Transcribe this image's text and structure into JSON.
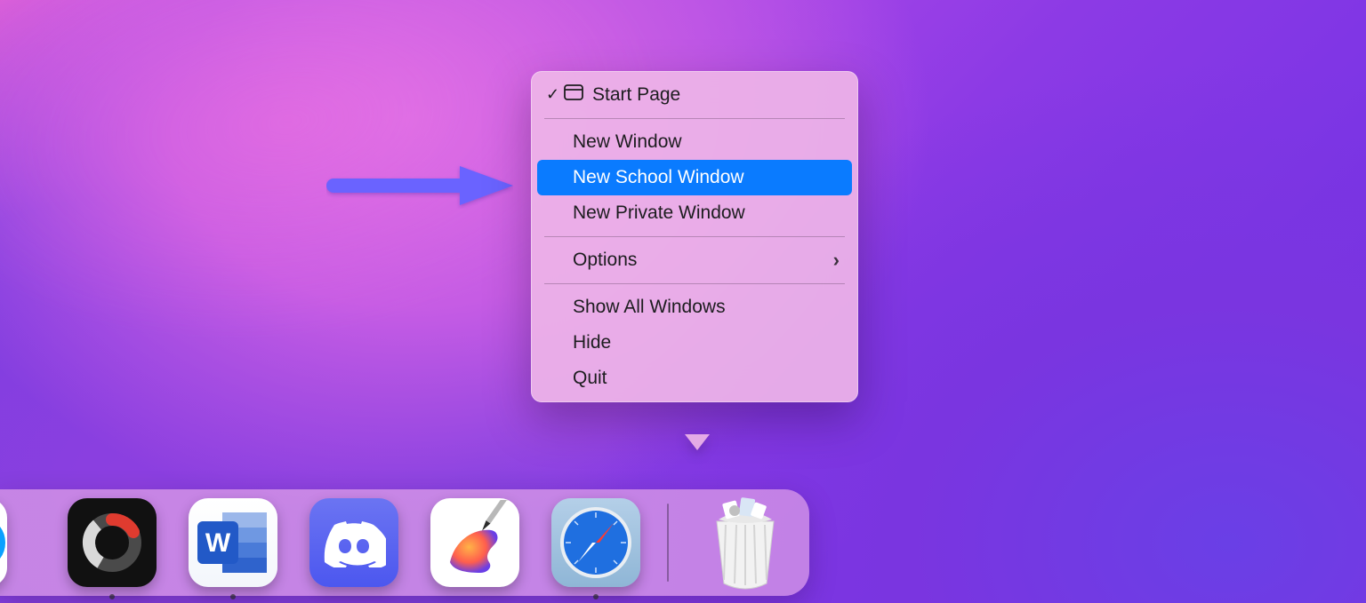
{
  "context_menu": {
    "checked_item": "Start Page",
    "items": {
      "new_window": "New Window",
      "new_school_window": "New School Window",
      "new_private_window": "New Private Window",
      "options": "Options",
      "show_all_windows": "Show All Windows",
      "hide": "Hide",
      "quit": "Quit"
    },
    "selected_key": "new_school_window"
  },
  "colors": {
    "selection": "#0a7bff",
    "menu_bg": "rgba(238,180,232,0.92)"
  },
  "dock": {
    "apps": [
      {
        "name": "partial-app",
        "running": false
      },
      {
        "name": "system-ring-app",
        "running": true
      },
      {
        "name": "microsoft-word",
        "running": true
      },
      {
        "name": "discord",
        "running": false
      },
      {
        "name": "paint-app",
        "running": false
      },
      {
        "name": "safari",
        "running": true
      }
    ],
    "trash_full": true
  }
}
